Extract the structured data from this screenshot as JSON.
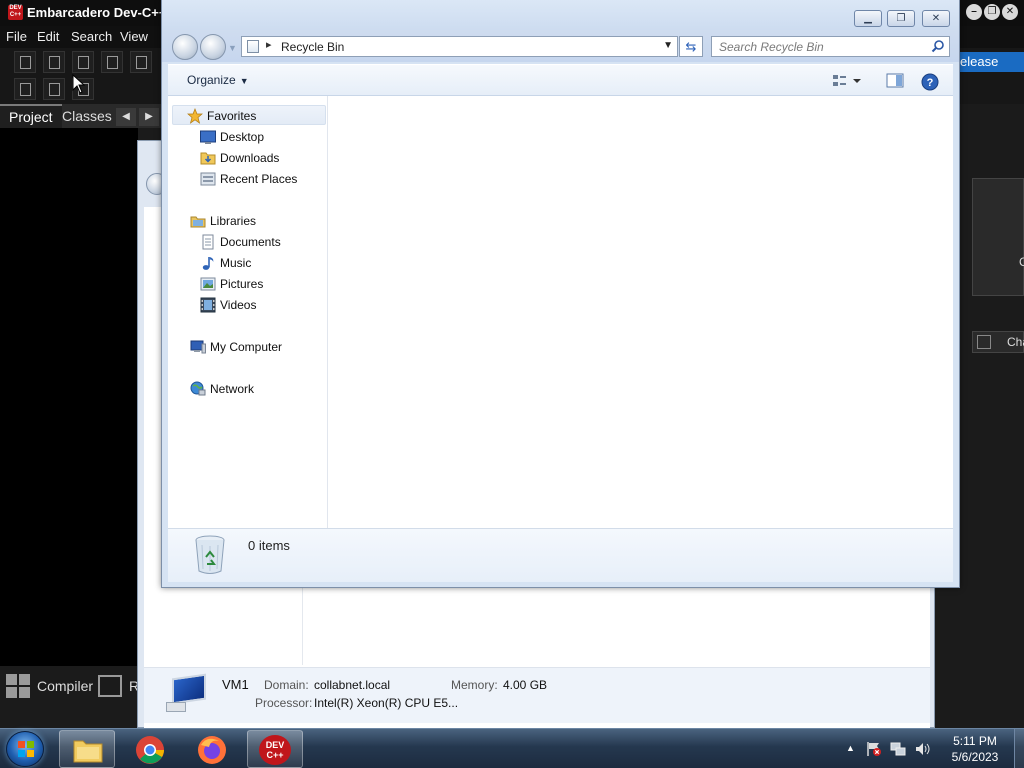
{
  "devcpp": {
    "title": "Embarcadero Dev-C++",
    "logo_text": "DEV C++",
    "menu": [
      "File",
      "Edit",
      "Search",
      "View"
    ],
    "tabs": [
      "Project",
      "Classes"
    ],
    "release_label": "elease",
    "right_cha": "Cha",
    "right_panel_c": "C",
    "bottom_compiler": "Compiler",
    "bottom_r": "R"
  },
  "sysprops": {
    "computer_name": "VM1",
    "domain_label": "Domain:",
    "domain_value": "collabnet.local",
    "memory_label": "Memory:",
    "memory_value": "4.00 GB",
    "processor_label": "Processor:",
    "processor_value": "Intel(R) Xeon(R) CPU E5..."
  },
  "explorer": {
    "address": "Recycle Bin",
    "search_placeholder": "Search Recycle Bin",
    "organize_label": "Organize",
    "nav": {
      "favorites": "Favorites",
      "desktop": "Desktop",
      "downloads": "Downloads",
      "recent_places": "Recent Places",
      "libraries": "Libraries",
      "documents": "Documents",
      "music": "Music",
      "pictures": "Pictures",
      "videos": "Videos",
      "my_computer": "My Computer",
      "network": "Network"
    },
    "items_count": "0 items"
  },
  "taskbar": {
    "time": "5:11 PM",
    "date": "5/6/2023",
    "devcpp_badge": "DEV C++"
  },
  "colors": {
    "accent_blue": "#1a6bc2",
    "devcpp_red": "#c0161b"
  }
}
